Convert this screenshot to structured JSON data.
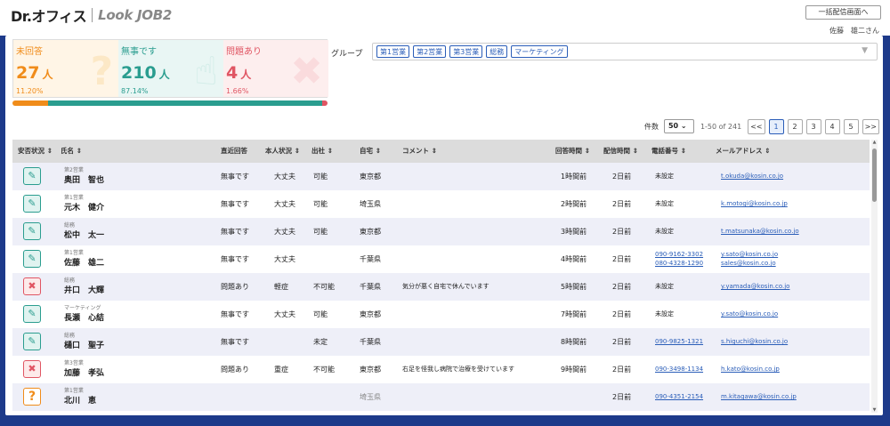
{
  "header": {
    "logo_dr": "Dr.",
    "logo_office": "オフィス",
    "logo_product": "Look JOB2",
    "bulk_button": "一括配信画面へ",
    "user": "佐藤　雄二さん"
  },
  "stats": {
    "unanswered": {
      "label": "未回答",
      "count": "27",
      "unit": "人",
      "percent": "11.20%",
      "icon": "question-icon"
    },
    "safe": {
      "label": "無事です",
      "count": "210",
      "unit": "人",
      "percent": "87.14%",
      "icon": "thumbs-up-icon"
    },
    "trouble": {
      "label": "問題あり",
      "count": "4",
      "unit": "人",
      "percent": "1.66%",
      "icon": "bandage-icon"
    }
  },
  "progress": {
    "unanswered": 11.2,
    "safe": 87.14,
    "trouble": 1.66
  },
  "group": {
    "label": "グループ",
    "tags": [
      "第1営業",
      "第2営業",
      "第3営業",
      "総務",
      "マーケティング"
    ]
  },
  "pager": {
    "count_label": "件数",
    "per_page": "50",
    "range": "1-50 of 241",
    "first": "<<",
    "pages": [
      "1",
      "2",
      "3",
      "4",
      "5"
    ],
    "next": ">>"
  },
  "columns": {
    "status": "安否状況 ⇕",
    "name": "氏名 ⇕",
    "recent": "直近回答",
    "condition": "本人状況 ⇕",
    "attendance": "出社 ⇕",
    "home": "自宅 ⇕",
    "comment": "コメント ⇕",
    "answer_time": "回答時間 ⇕",
    "sent_time": "配信時間 ⇕",
    "phone": "電話番号 ⇕",
    "email": "メールアドレス ⇕"
  },
  "rows": [
    {
      "status": "ok",
      "group": "第2営業",
      "name": "奥田　智也",
      "recent": "無事です",
      "condition": "大丈夫",
      "attendance": "可能",
      "home": "東京都",
      "comment": "",
      "answer_time": "1時間前",
      "sent_time": "2日前",
      "phone": "未設定",
      "phone2": "",
      "email": "t.okuda@kosin.co.jo",
      "email2": ""
    },
    {
      "status": "ok",
      "group": "第1営業",
      "name": "元木　健介",
      "recent": "無事です",
      "condition": "大丈夫",
      "attendance": "可能",
      "home": "埼玉県",
      "comment": "",
      "answer_time": "2時間前",
      "sent_time": "2日前",
      "phone": "未設定",
      "phone2": "",
      "email": "k.motogi@kosin.co.jp",
      "email2": ""
    },
    {
      "status": "ok",
      "group": "総務",
      "name": "松中　太一",
      "recent": "無事です",
      "condition": "大丈夫",
      "attendance": "可能",
      "home": "東京都",
      "comment": "",
      "answer_time": "3時間前",
      "sent_time": "2日前",
      "phone": "未設定",
      "phone2": "",
      "email": "t.matsunaka@kosin.co.jo",
      "email2": ""
    },
    {
      "status": "ok",
      "group": "第1営業",
      "name": "佐藤　雄二",
      "recent": "無事です",
      "condition": "大丈夫",
      "attendance": "",
      "home": "千葉県",
      "comment": "",
      "answer_time": "4時間前",
      "sent_time": "2日前",
      "phone": "090-9162-3302",
      "phone2": "080-4328-1290",
      "email": "y.sato@kosin.co.jo",
      "email2": "sales@kosin.co.jo"
    },
    {
      "status": "bad",
      "group": "総務",
      "name": "井口　大輝",
      "recent": "問題あり",
      "condition": "軽症",
      "attendance": "不可能",
      "home": "千葉県",
      "comment": "気分が悪く自宅で休んでいます",
      "answer_time": "5時間前",
      "sent_time": "2日前",
      "phone": "未設定",
      "phone2": "",
      "email": "y.yamada@kosin.co.jo",
      "email2": ""
    },
    {
      "status": "ok",
      "group": "マーケティング",
      "name": "長瀬　心結",
      "recent": "無事です",
      "condition": "大丈夫",
      "attendance": "可能",
      "home": "東京都",
      "comment": "",
      "answer_time": "7時間前",
      "sent_time": "2日前",
      "phone": "未設定",
      "phone2": "",
      "email": "y.sato@kosin.co.jo",
      "email2": ""
    },
    {
      "status": "ok",
      "group": "総務",
      "name": "樋口　聖子",
      "recent": "無事です",
      "condition": "",
      "attendance": "未定",
      "home": "千葉県",
      "comment": "",
      "answer_time": "8時間前",
      "sent_time": "2日前",
      "phone": "090-9825-1321",
      "phone2": "",
      "email": "s.higuchi@kosin.co.jo",
      "email2": ""
    },
    {
      "status": "bad",
      "group": "第3営業",
      "name": "加藤　孝弘",
      "recent": "問題あり",
      "condition": "重症",
      "attendance": "不可能",
      "home": "東京都",
      "comment": "右足を怪我し病院で治療を受けています",
      "answer_time": "9時間前",
      "sent_time": "2日前",
      "phone": "090-3498-1134",
      "phone2": "",
      "email": "h.kato@kosin.co.jp",
      "email2": ""
    },
    {
      "status": "unk",
      "group": "第1営業",
      "name": "北川　恵",
      "recent": "",
      "condition": "",
      "attendance": "",
      "home": "埼玉県",
      "comment": "",
      "answer_time": "",
      "sent_time": "2日前",
      "phone": "090-4351-2154",
      "phone2": "",
      "email": "m.kitagawa@kosin.co.jp",
      "email2": ""
    }
  ],
  "colors": {
    "unanswered": "#f08c1a",
    "safe": "#2a9d8f",
    "trouble": "#e05563",
    "link": "#2a5db8",
    "frame": "#1d3a8a"
  }
}
